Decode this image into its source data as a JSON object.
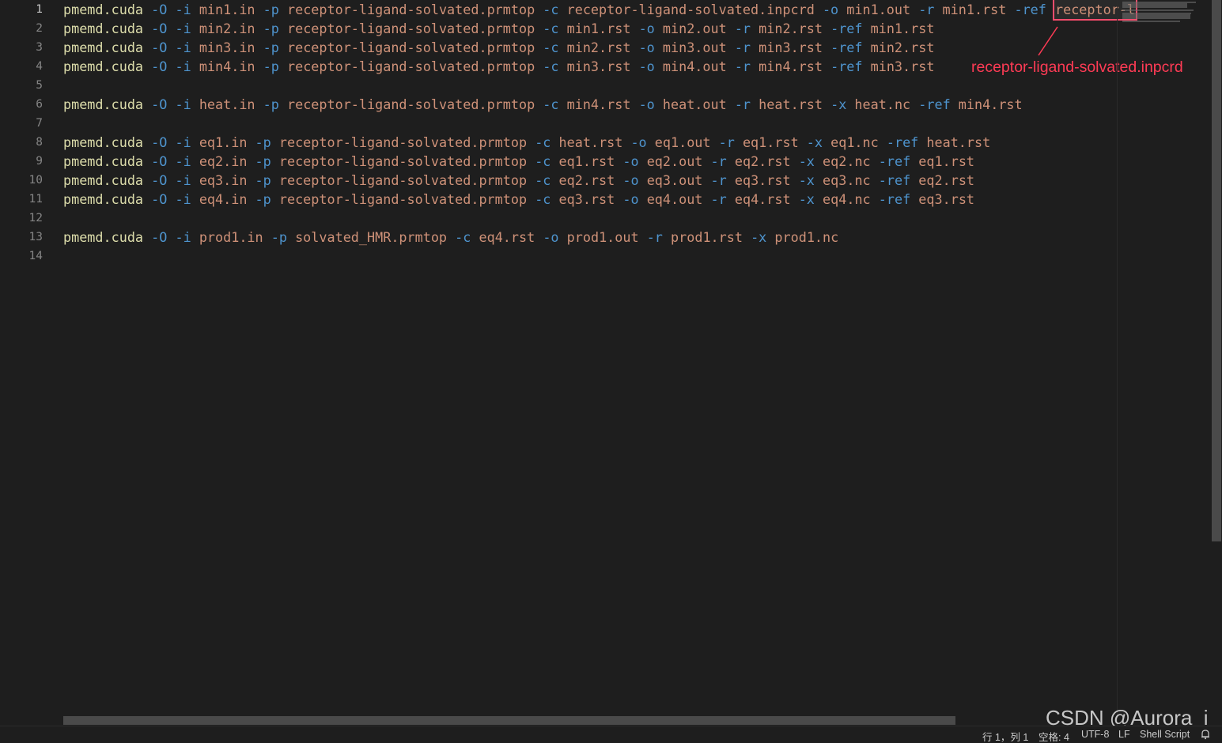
{
  "editor": {
    "line_numbers": [
      "1",
      "2",
      "3",
      "4",
      "5",
      "6",
      "7",
      "8",
      "9",
      "10",
      "11",
      "12",
      "13",
      "14"
    ],
    "lines": [
      [
        [
          "cmd",
          "pmemd.cuda"
        ],
        [
          "sp",
          " "
        ],
        [
          "flag",
          "-O"
        ],
        [
          "sp",
          " "
        ],
        [
          "flag",
          "-i"
        ],
        [
          "sp",
          " "
        ],
        [
          "arg",
          "min1.in"
        ],
        [
          "sp",
          " "
        ],
        [
          "flag",
          "-p"
        ],
        [
          "sp",
          " "
        ],
        [
          "arg",
          "receptor-ligand-solvated.prmtop"
        ],
        [
          "sp",
          " "
        ],
        [
          "flag",
          "-c"
        ],
        [
          "sp",
          " "
        ],
        [
          "arg",
          "receptor-ligand-solvated.inpcrd"
        ],
        [
          "sp",
          " "
        ],
        [
          "flag",
          "-o"
        ],
        [
          "sp",
          " "
        ],
        [
          "arg",
          "min1.out"
        ],
        [
          "sp",
          " "
        ],
        [
          "flag",
          "-r"
        ],
        [
          "sp",
          " "
        ],
        [
          "arg",
          "min1.rst"
        ],
        [
          "sp",
          " "
        ],
        [
          "flag",
          "-ref"
        ],
        [
          "sp",
          " "
        ]
      ],
      [
        [
          "cmd",
          "pmemd.cuda"
        ],
        [
          "sp",
          " "
        ],
        [
          "flag",
          "-O"
        ],
        [
          "sp",
          " "
        ],
        [
          "flag",
          "-i"
        ],
        [
          "sp",
          " "
        ],
        [
          "arg",
          "min2.in"
        ],
        [
          "sp",
          " "
        ],
        [
          "flag",
          "-p"
        ],
        [
          "sp",
          " "
        ],
        [
          "arg",
          "receptor-ligand-solvated.prmtop"
        ],
        [
          "sp",
          " "
        ],
        [
          "flag",
          "-c"
        ],
        [
          "sp",
          " "
        ],
        [
          "arg",
          "min1.rst"
        ],
        [
          "sp",
          " "
        ],
        [
          "flag",
          "-o"
        ],
        [
          "sp",
          " "
        ],
        [
          "arg",
          "min2.out"
        ],
        [
          "sp",
          " "
        ],
        [
          "flag",
          "-r"
        ],
        [
          "sp",
          " "
        ],
        [
          "arg",
          "min2.rst"
        ],
        [
          "sp",
          " "
        ],
        [
          "flag",
          "-ref"
        ],
        [
          "sp",
          " "
        ],
        [
          "arg",
          "min1.rst"
        ]
      ],
      [
        [
          "cmd",
          "pmemd.cuda"
        ],
        [
          "sp",
          " "
        ],
        [
          "flag",
          "-O"
        ],
        [
          "sp",
          " "
        ],
        [
          "flag",
          "-i"
        ],
        [
          "sp",
          " "
        ],
        [
          "arg",
          "min3.in"
        ],
        [
          "sp",
          " "
        ],
        [
          "flag",
          "-p"
        ],
        [
          "sp",
          " "
        ],
        [
          "arg",
          "receptor-ligand-solvated.prmtop"
        ],
        [
          "sp",
          " "
        ],
        [
          "flag",
          "-c"
        ],
        [
          "sp",
          " "
        ],
        [
          "arg",
          "min2.rst"
        ],
        [
          "sp",
          " "
        ],
        [
          "flag",
          "-o"
        ],
        [
          "sp",
          " "
        ],
        [
          "arg",
          "min3.out"
        ],
        [
          "sp",
          " "
        ],
        [
          "flag",
          "-r"
        ],
        [
          "sp",
          " "
        ],
        [
          "arg",
          "min3.rst"
        ],
        [
          "sp",
          " "
        ],
        [
          "flag",
          "-ref"
        ],
        [
          "sp",
          " "
        ],
        [
          "arg",
          "min2.rst"
        ]
      ],
      [
        [
          "cmd",
          "pmemd.cuda"
        ],
        [
          "sp",
          " "
        ],
        [
          "flag",
          "-O"
        ],
        [
          "sp",
          " "
        ],
        [
          "flag",
          "-i"
        ],
        [
          "sp",
          " "
        ],
        [
          "arg",
          "min4.in"
        ],
        [
          "sp",
          " "
        ],
        [
          "flag",
          "-p"
        ],
        [
          "sp",
          " "
        ],
        [
          "arg",
          "receptor-ligand-solvated.prmtop"
        ],
        [
          "sp",
          " "
        ],
        [
          "flag",
          "-c"
        ],
        [
          "sp",
          " "
        ],
        [
          "arg",
          "min3.rst"
        ],
        [
          "sp",
          " "
        ],
        [
          "flag",
          "-o"
        ],
        [
          "sp",
          " "
        ],
        [
          "arg",
          "min4.out"
        ],
        [
          "sp",
          " "
        ],
        [
          "flag",
          "-r"
        ],
        [
          "sp",
          " "
        ],
        [
          "arg",
          "min4.rst"
        ],
        [
          "sp",
          " "
        ],
        [
          "flag",
          "-ref"
        ],
        [
          "sp",
          " "
        ],
        [
          "arg",
          "min3.rst"
        ]
      ],
      [],
      [
        [
          "cmd",
          "pmemd.cuda"
        ],
        [
          "sp",
          " "
        ],
        [
          "flag",
          "-O"
        ],
        [
          "sp",
          " "
        ],
        [
          "flag",
          "-i"
        ],
        [
          "sp",
          " "
        ],
        [
          "arg",
          "heat.in"
        ],
        [
          "sp",
          " "
        ],
        [
          "flag",
          "-p"
        ],
        [
          "sp",
          " "
        ],
        [
          "arg",
          "receptor-ligand-solvated.prmtop"
        ],
        [
          "sp",
          " "
        ],
        [
          "flag",
          "-c"
        ],
        [
          "sp",
          " "
        ],
        [
          "arg",
          "min4.rst"
        ],
        [
          "sp",
          " "
        ],
        [
          "flag",
          "-o"
        ],
        [
          "sp",
          " "
        ],
        [
          "arg",
          "heat.out"
        ],
        [
          "sp",
          " "
        ],
        [
          "flag",
          "-r"
        ],
        [
          "sp",
          " "
        ],
        [
          "arg",
          "heat.rst"
        ],
        [
          "sp",
          " "
        ],
        [
          "flag",
          "-x"
        ],
        [
          "sp",
          " "
        ],
        [
          "arg",
          "heat.nc"
        ],
        [
          "sp",
          " "
        ],
        [
          "flag",
          "-ref"
        ],
        [
          "sp",
          " "
        ],
        [
          "arg",
          "min4.rst"
        ]
      ],
      [],
      [
        [
          "cmd",
          "pmemd.cuda"
        ],
        [
          "sp",
          " "
        ],
        [
          "flag",
          "-O"
        ],
        [
          "sp",
          " "
        ],
        [
          "flag",
          "-i"
        ],
        [
          "sp",
          " "
        ],
        [
          "arg",
          "eq1.in"
        ],
        [
          "sp",
          " "
        ],
        [
          "flag",
          "-p"
        ],
        [
          "sp",
          " "
        ],
        [
          "arg",
          "receptor-ligand-solvated.prmtop"
        ],
        [
          "sp",
          " "
        ],
        [
          "flag",
          "-c"
        ],
        [
          "sp",
          " "
        ],
        [
          "arg",
          "heat.rst"
        ],
        [
          "sp",
          " "
        ],
        [
          "flag",
          "-o"
        ],
        [
          "sp",
          " "
        ],
        [
          "arg",
          "eq1.out"
        ],
        [
          "sp",
          " "
        ],
        [
          "flag",
          "-r"
        ],
        [
          "sp",
          " "
        ],
        [
          "arg",
          "eq1.rst"
        ],
        [
          "sp",
          " "
        ],
        [
          "flag",
          "-x"
        ],
        [
          "sp",
          " "
        ],
        [
          "arg",
          "eq1.nc"
        ],
        [
          "sp",
          " "
        ],
        [
          "flag",
          "-ref"
        ],
        [
          "sp",
          " "
        ],
        [
          "arg",
          "heat.rst"
        ]
      ],
      [
        [
          "cmd",
          "pmemd.cuda"
        ],
        [
          "sp",
          " "
        ],
        [
          "flag",
          "-O"
        ],
        [
          "sp",
          " "
        ],
        [
          "flag",
          "-i"
        ],
        [
          "sp",
          " "
        ],
        [
          "arg",
          "eq2.in"
        ],
        [
          "sp",
          " "
        ],
        [
          "flag",
          "-p"
        ],
        [
          "sp",
          " "
        ],
        [
          "arg",
          "receptor-ligand-solvated.prmtop"
        ],
        [
          "sp",
          " "
        ],
        [
          "flag",
          "-c"
        ],
        [
          "sp",
          " "
        ],
        [
          "arg",
          "eq1.rst"
        ],
        [
          "sp",
          " "
        ],
        [
          "flag",
          "-o"
        ],
        [
          "sp",
          " "
        ],
        [
          "arg",
          "eq2.out"
        ],
        [
          "sp",
          " "
        ],
        [
          "flag",
          "-r"
        ],
        [
          "sp",
          " "
        ],
        [
          "arg",
          "eq2.rst"
        ],
        [
          "sp",
          " "
        ],
        [
          "flag",
          "-x"
        ],
        [
          "sp",
          " "
        ],
        [
          "arg",
          "eq2.nc"
        ],
        [
          "sp",
          " "
        ],
        [
          "flag",
          "-ref"
        ],
        [
          "sp",
          " "
        ],
        [
          "arg",
          "eq1.rst"
        ]
      ],
      [
        [
          "cmd",
          "pmemd.cuda"
        ],
        [
          "sp",
          " "
        ],
        [
          "flag",
          "-O"
        ],
        [
          "sp",
          " "
        ],
        [
          "flag",
          "-i"
        ],
        [
          "sp",
          " "
        ],
        [
          "arg",
          "eq3.in"
        ],
        [
          "sp",
          " "
        ],
        [
          "flag",
          "-p"
        ],
        [
          "sp",
          " "
        ],
        [
          "arg",
          "receptor-ligand-solvated.prmtop"
        ],
        [
          "sp",
          " "
        ],
        [
          "flag",
          "-c"
        ],
        [
          "sp",
          " "
        ],
        [
          "arg",
          "eq2.rst"
        ],
        [
          "sp",
          " "
        ],
        [
          "flag",
          "-o"
        ],
        [
          "sp",
          " "
        ],
        [
          "arg",
          "eq3.out"
        ],
        [
          "sp",
          " "
        ],
        [
          "flag",
          "-r"
        ],
        [
          "sp",
          " "
        ],
        [
          "arg",
          "eq3.rst"
        ],
        [
          "sp",
          " "
        ],
        [
          "flag",
          "-x"
        ],
        [
          "sp",
          " "
        ],
        [
          "arg",
          "eq3.nc"
        ],
        [
          "sp",
          " "
        ],
        [
          "flag",
          "-ref"
        ],
        [
          "sp",
          " "
        ],
        [
          "arg",
          "eq2.rst"
        ]
      ],
      [
        [
          "cmd",
          "pmemd.cuda"
        ],
        [
          "sp",
          " "
        ],
        [
          "flag",
          "-O"
        ],
        [
          "sp",
          " "
        ],
        [
          "flag",
          "-i"
        ],
        [
          "sp",
          " "
        ],
        [
          "arg",
          "eq4.in"
        ],
        [
          "sp",
          " "
        ],
        [
          "flag",
          "-p"
        ],
        [
          "sp",
          " "
        ],
        [
          "arg",
          "receptor-ligand-solvated.prmtop"
        ],
        [
          "sp",
          " "
        ],
        [
          "flag",
          "-c"
        ],
        [
          "sp",
          " "
        ],
        [
          "arg",
          "eq3.rst"
        ],
        [
          "sp",
          " "
        ],
        [
          "flag",
          "-o"
        ],
        [
          "sp",
          " "
        ],
        [
          "arg",
          "eq4.out"
        ],
        [
          "sp",
          " "
        ],
        [
          "flag",
          "-r"
        ],
        [
          "sp",
          " "
        ],
        [
          "arg",
          "eq4.rst"
        ],
        [
          "sp",
          " "
        ],
        [
          "flag",
          "-x"
        ],
        [
          "sp",
          " "
        ],
        [
          "arg",
          "eq4.nc"
        ],
        [
          "sp",
          " "
        ],
        [
          "flag",
          "-ref"
        ],
        [
          "sp",
          " "
        ],
        [
          "arg",
          "eq3.rst"
        ]
      ],
      [],
      [
        [
          "cmd",
          "pmemd.cuda"
        ],
        [
          "sp",
          " "
        ],
        [
          "flag",
          "-O"
        ],
        [
          "sp",
          " "
        ],
        [
          "flag",
          "-i"
        ],
        [
          "sp",
          " "
        ],
        [
          "arg",
          "prod1.in"
        ],
        [
          "sp",
          " "
        ],
        [
          "flag",
          "-p"
        ],
        [
          "sp",
          " "
        ],
        [
          "arg",
          "solvated_HMR.prmtop"
        ],
        [
          "sp",
          " "
        ],
        [
          "flag",
          "-c"
        ],
        [
          "sp",
          " "
        ],
        [
          "arg",
          "eq4.rst"
        ],
        [
          "sp",
          " "
        ],
        [
          "flag",
          "-o"
        ],
        [
          "sp",
          " "
        ],
        [
          "arg",
          "prod1.out"
        ],
        [
          "sp",
          " "
        ],
        [
          "flag",
          "-r"
        ],
        [
          "sp",
          " "
        ],
        [
          "arg",
          "prod1.rst"
        ],
        [
          "sp",
          " "
        ],
        [
          "flag",
          "-x"
        ],
        [
          "sp",
          " "
        ],
        [
          "arg",
          "prod1.nc"
        ]
      ],
      []
    ],
    "line1_highlighted_tail": "receptor-l"
  },
  "annotation": {
    "text": "receptor-ligand-solvated.inpcrd",
    "color": "#ff3b55"
  },
  "statusbar": {
    "position": "行 1，列 1",
    "indent": "空格: 4",
    "encoding": "UTF-8",
    "eol": "LF",
    "language": "Shell Script",
    "bell_icon": "bell-icon"
  },
  "watermark": "CSDN @Aurora_i",
  "colors": {
    "background": "#1e1e1e",
    "command": "#dcdcaa",
    "flag": "#4e94ce",
    "argument": "#ce9178",
    "line_number": "#858585"
  }
}
